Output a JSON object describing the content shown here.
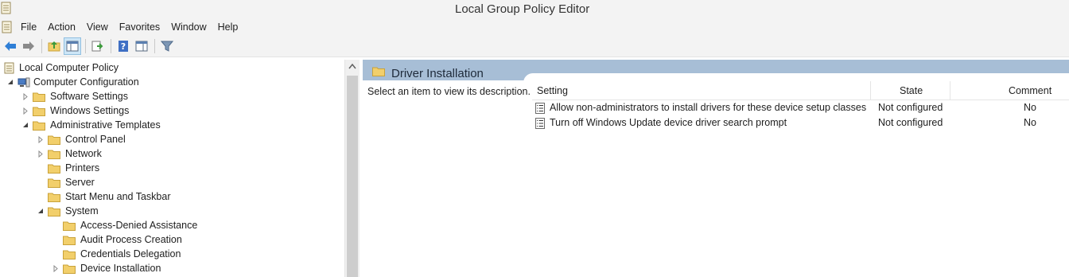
{
  "window": {
    "title": "Local Group Policy Editor"
  },
  "menu": [
    "File",
    "Action",
    "View",
    "Favorites",
    "Window",
    "Help"
  ],
  "toolbar": {
    "buttons": [
      "back-icon",
      "forward-icon",
      "up-folder-icon",
      "show-hide-tree-icon",
      "export-list-icon",
      "help-icon",
      "show-hide-action-pane-icon",
      "filter-icon"
    ]
  },
  "tree": {
    "root": "Local Computer Policy",
    "computer_configuration": "Computer Configuration",
    "software_settings": "Software Settings",
    "windows_settings": "Windows Settings",
    "administrative_templates": "Administrative Templates",
    "control_panel": "Control Panel",
    "network": "Network",
    "printers": "Printers",
    "server": "Server",
    "start_menu": "Start Menu and Taskbar",
    "system": "System",
    "access_denied": "Access-Denied Assistance",
    "audit_process": "Audit Process Creation",
    "credentials_delegation": "Credentials Delegation",
    "device_installation": "Device Installation"
  },
  "details": {
    "header_title": "Driver Installation",
    "description": "Select an item to view its description.",
    "columns": {
      "setting": "Setting",
      "state": "State",
      "comment": "Comment"
    },
    "rows": [
      {
        "setting": "Allow non-administrators to install drivers for these device setup classes",
        "state": "Not configured",
        "comment": "No"
      },
      {
        "setting": "Turn off Windows Update device driver search prompt",
        "state": "Not configured",
        "comment": "No"
      }
    ]
  },
  "colors": {
    "header_band": "#a7bed6",
    "folder": "#f2cf6b",
    "toolbar_bg": "#f3f3f3"
  }
}
